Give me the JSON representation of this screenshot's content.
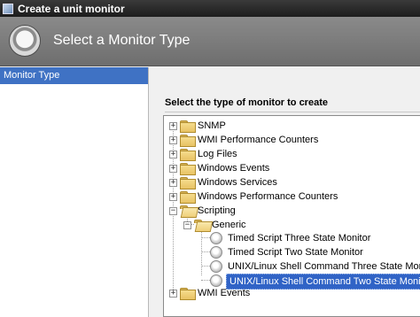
{
  "window": {
    "title": "Create a unit monitor"
  },
  "header": {
    "title": "Select a Monitor Type"
  },
  "nav": {
    "selected_item": "Monitor Type"
  },
  "section": {
    "title": "Select the type of monitor to create"
  },
  "tree": {
    "snmp": "SNMP",
    "wmi_perf": "WMI Performance Counters",
    "log_files": "Log Files",
    "windows_events": "Windows Events",
    "windows_services": "Windows Services",
    "windows_perf": "Windows Performance Counters",
    "scripting": "Scripting",
    "generic": "Generic",
    "timed_three": "Timed Script Three State Monitor",
    "timed_two": "Timed Script Two State Monitor",
    "unix_three": "UNIX/Linux Shell Command Three State Monitor",
    "unix_two": "UNIX/Linux Shell Command Two State Monitor",
    "wmi_events": "WMI Events",
    "expand_symbol": "+",
    "collapse_symbol": "−"
  }
}
